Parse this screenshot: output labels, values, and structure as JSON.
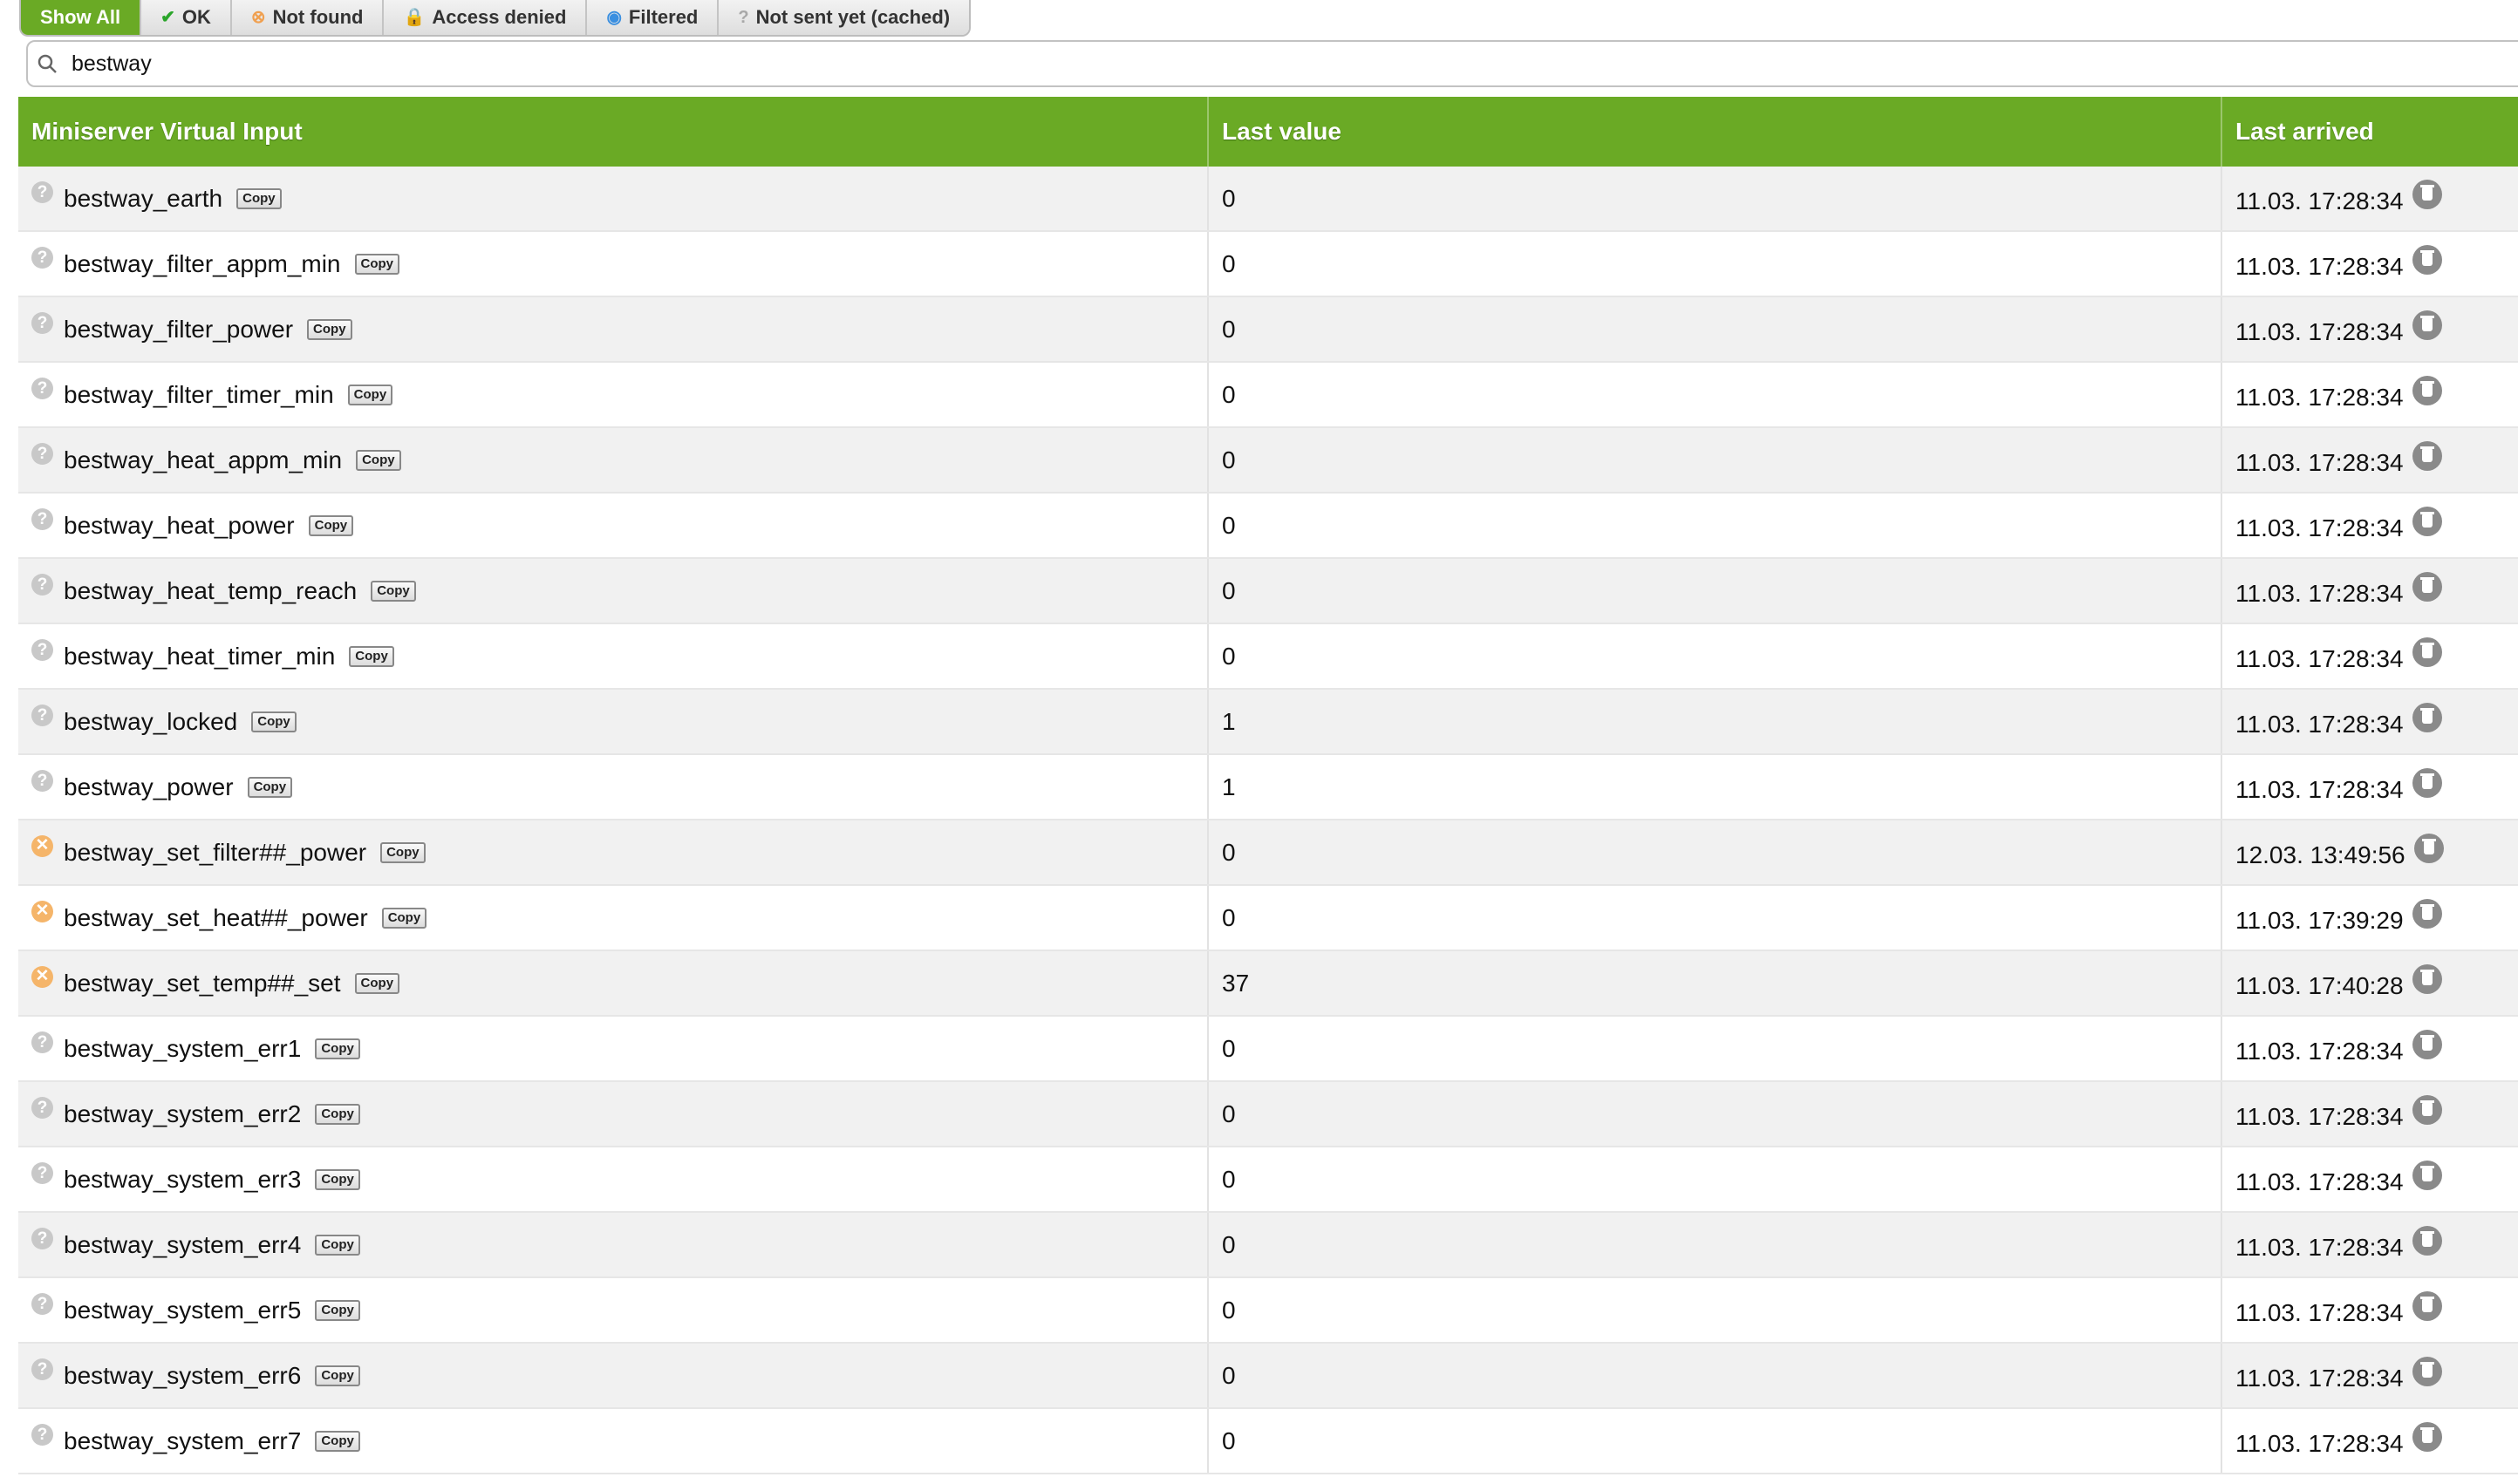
{
  "filters": [
    {
      "label": "Show All",
      "icon": "",
      "active": true
    },
    {
      "label": "OK",
      "icon": "check-icon",
      "active": false
    },
    {
      "label": "Not found",
      "icon": "not-found-icon",
      "active": false
    },
    {
      "label": "Access denied",
      "icon": "lock-icon",
      "active": false
    },
    {
      "label": "Filtered",
      "icon": "filter-icon",
      "active": false
    },
    {
      "label": "Not sent yet (cached)",
      "icon": "question-icon",
      "active": false
    }
  ],
  "search": {
    "value": "bestway"
  },
  "table": {
    "headers": [
      "Miniserver Virtual Input",
      "Last value",
      "Last arrived"
    ],
    "copy_label": "Copy",
    "rows": [
      {
        "status": "not-sent",
        "name": "bestway_earth",
        "value": "0",
        "arrived": "11.03. 17:28:34"
      },
      {
        "status": "not-sent",
        "name": "bestway_filter_appm_min",
        "value": "0",
        "arrived": "11.03. 17:28:34"
      },
      {
        "status": "not-sent",
        "name": "bestway_filter_power",
        "value": "0",
        "arrived": "11.03. 17:28:34"
      },
      {
        "status": "not-sent",
        "name": "bestway_filter_timer_min",
        "value": "0",
        "arrived": "11.03. 17:28:34"
      },
      {
        "status": "not-sent",
        "name": "bestway_heat_appm_min",
        "value": "0",
        "arrived": "11.03. 17:28:34"
      },
      {
        "status": "not-sent",
        "name": "bestway_heat_power",
        "value": "0",
        "arrived": "11.03. 17:28:34"
      },
      {
        "status": "not-sent",
        "name": "bestway_heat_temp_reach",
        "value": "0",
        "arrived": "11.03. 17:28:34"
      },
      {
        "status": "not-sent",
        "name": "bestway_heat_timer_min",
        "value": "0",
        "arrived": "11.03. 17:28:34"
      },
      {
        "status": "not-sent",
        "name": "bestway_locked",
        "value": "1",
        "arrived": "11.03. 17:28:34"
      },
      {
        "status": "not-sent",
        "name": "bestway_power",
        "value": "1",
        "arrived": "11.03. 17:28:34"
      },
      {
        "status": "not-found",
        "name": "bestway_set_filter##_power",
        "value": "0",
        "arrived": "12.03. 13:49:56"
      },
      {
        "status": "not-found",
        "name": "bestway_set_heat##_power",
        "value": "0",
        "arrived": "11.03. 17:39:29"
      },
      {
        "status": "not-found",
        "name": "bestway_set_temp##_set",
        "value": "37",
        "arrived": "11.03. 17:40:28"
      },
      {
        "status": "not-sent",
        "name": "bestway_system_err1",
        "value": "0",
        "arrived": "11.03. 17:28:34"
      },
      {
        "status": "not-sent",
        "name": "bestway_system_err2",
        "value": "0",
        "arrived": "11.03. 17:28:34"
      },
      {
        "status": "not-sent",
        "name": "bestway_system_err3",
        "value": "0",
        "arrived": "11.03. 17:28:34"
      },
      {
        "status": "not-sent",
        "name": "bestway_system_err4",
        "value": "0",
        "arrived": "11.03. 17:28:34"
      },
      {
        "status": "not-sent",
        "name": "bestway_system_err5",
        "value": "0",
        "arrived": "11.03. 17:28:34"
      },
      {
        "status": "not-sent",
        "name": "bestway_system_err6",
        "value": "0",
        "arrived": "11.03. 17:28:34"
      },
      {
        "status": "not-sent",
        "name": "bestway_system_err7",
        "value": "0",
        "arrived": "11.03. 17:28:34"
      }
    ]
  },
  "colors": {
    "accent": "#6aaa25",
    "row_alt": "#f1f1f1"
  }
}
